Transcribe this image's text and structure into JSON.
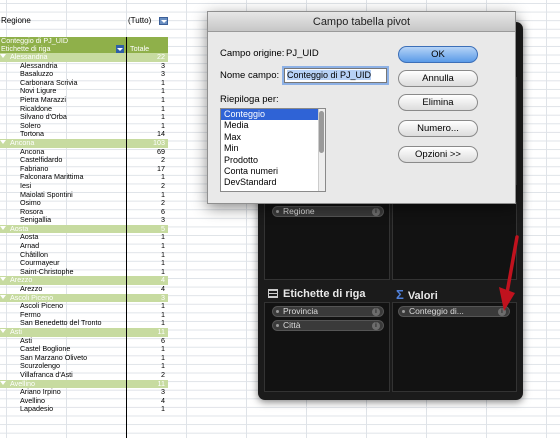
{
  "filter": {
    "label": "Regione",
    "value": "(Tutto)"
  },
  "pivot": {
    "value_header": "Conteggio di PJ_UID",
    "row_header": "Etichette di riga",
    "total_header": "Totale",
    "rows": [
      {
        "type": "group",
        "name": "Alessandria",
        "value": "22"
      },
      {
        "type": "item",
        "name": "Alessandria",
        "value": "3"
      },
      {
        "type": "item",
        "name": "Basaluzzo",
        "value": "3"
      },
      {
        "type": "item",
        "name": "Carbonara Scrivia",
        "value": "1"
      },
      {
        "type": "item",
        "name": "Novi Ligure",
        "value": "1"
      },
      {
        "type": "item",
        "name": "Pietra Marazzi",
        "value": "1"
      },
      {
        "type": "item",
        "name": "Ricaldone",
        "value": "1"
      },
      {
        "type": "item",
        "name": "Silvano d'Orba",
        "value": "1"
      },
      {
        "type": "item",
        "name": "Solero",
        "value": "1"
      },
      {
        "type": "item",
        "name": "Tortona",
        "value": "14"
      },
      {
        "type": "group",
        "name": "Ancona",
        "value": "103"
      },
      {
        "type": "item",
        "name": "Ancona",
        "value": "69"
      },
      {
        "type": "item",
        "name": "Castelfidardo",
        "value": "2"
      },
      {
        "type": "item",
        "name": "Fabriano",
        "value": "17"
      },
      {
        "type": "item",
        "name": "Falconara Marittima",
        "value": "1"
      },
      {
        "type": "item",
        "name": "Iesi",
        "value": "2"
      },
      {
        "type": "item",
        "name": "Maiolati Spontini",
        "value": "1"
      },
      {
        "type": "item",
        "name": "Osimo",
        "value": "2"
      },
      {
        "type": "item",
        "name": "Rosora",
        "value": "6"
      },
      {
        "type": "item",
        "name": "Senigallia",
        "value": "3"
      },
      {
        "type": "group",
        "name": "Aosta",
        "value": "5"
      },
      {
        "type": "item",
        "name": "Aosta",
        "value": "1"
      },
      {
        "type": "item",
        "name": "Arnad",
        "value": "1"
      },
      {
        "type": "item",
        "name": "Châtillon",
        "value": "1"
      },
      {
        "type": "item",
        "name": "Courmayeur",
        "value": "1"
      },
      {
        "type": "item",
        "name": "Saint-Christophe",
        "value": "1"
      },
      {
        "type": "group",
        "name": "Arezzo",
        "value": "4"
      },
      {
        "type": "item",
        "name": "Arezzo",
        "value": "4"
      },
      {
        "type": "group",
        "name": "Ascoli Piceno",
        "value": "3"
      },
      {
        "type": "item",
        "name": "Ascoli Piceno",
        "value": "1"
      },
      {
        "type": "item",
        "name": "Fermo",
        "value": "1"
      },
      {
        "type": "item",
        "name": "San Benedetto del Tronto",
        "value": "1"
      },
      {
        "type": "group",
        "name": "Asti",
        "value": "11"
      },
      {
        "type": "item",
        "name": "Asti",
        "value": "6"
      },
      {
        "type": "item",
        "name": "Castel Boglione",
        "value": "1"
      },
      {
        "type": "item",
        "name": "San Marzano Oliveto",
        "value": "1"
      },
      {
        "type": "item",
        "name": "Scurzolengo",
        "value": "1"
      },
      {
        "type": "item",
        "name": "Villafranca d'Asti",
        "value": "2"
      },
      {
        "type": "group",
        "name": "Avellino",
        "value": "11"
      },
      {
        "type": "item",
        "name": "Ariano Irpino",
        "value": "3"
      },
      {
        "type": "item",
        "name": "Avellino",
        "value": "4"
      },
      {
        "type": "item",
        "name": "Lapadesio",
        "value": "1"
      }
    ]
  },
  "panel": {
    "partial_col_title": "nna",
    "filter_pill": "Regione",
    "rows_title": "Etichette di riga",
    "values_title": "Valori",
    "row_pills": [
      "Provincia",
      "Città"
    ],
    "value_pill": "Conteggio di...",
    "info_glyph": "i",
    "accent_arrow_color": "#c0121e"
  },
  "dialog": {
    "title": "Campo tabella pivot",
    "source_label": "Campo origine:",
    "source_value": "PJ_UID",
    "name_label": "Nome campo:",
    "name_value": "Conteggio di PJ_UID",
    "summarize_label": "Riepiloga per:",
    "options": [
      "Conteggio",
      "Media",
      "Max",
      "Min",
      "Prodotto",
      "Conta numeri",
      "DevStandard"
    ],
    "selected_option": "Conteggio",
    "buttons": {
      "ok": "OK",
      "cancel": "Annulla",
      "delete": "Elimina",
      "number": "Numero...",
      "options": "Opzioni >>"
    }
  }
}
